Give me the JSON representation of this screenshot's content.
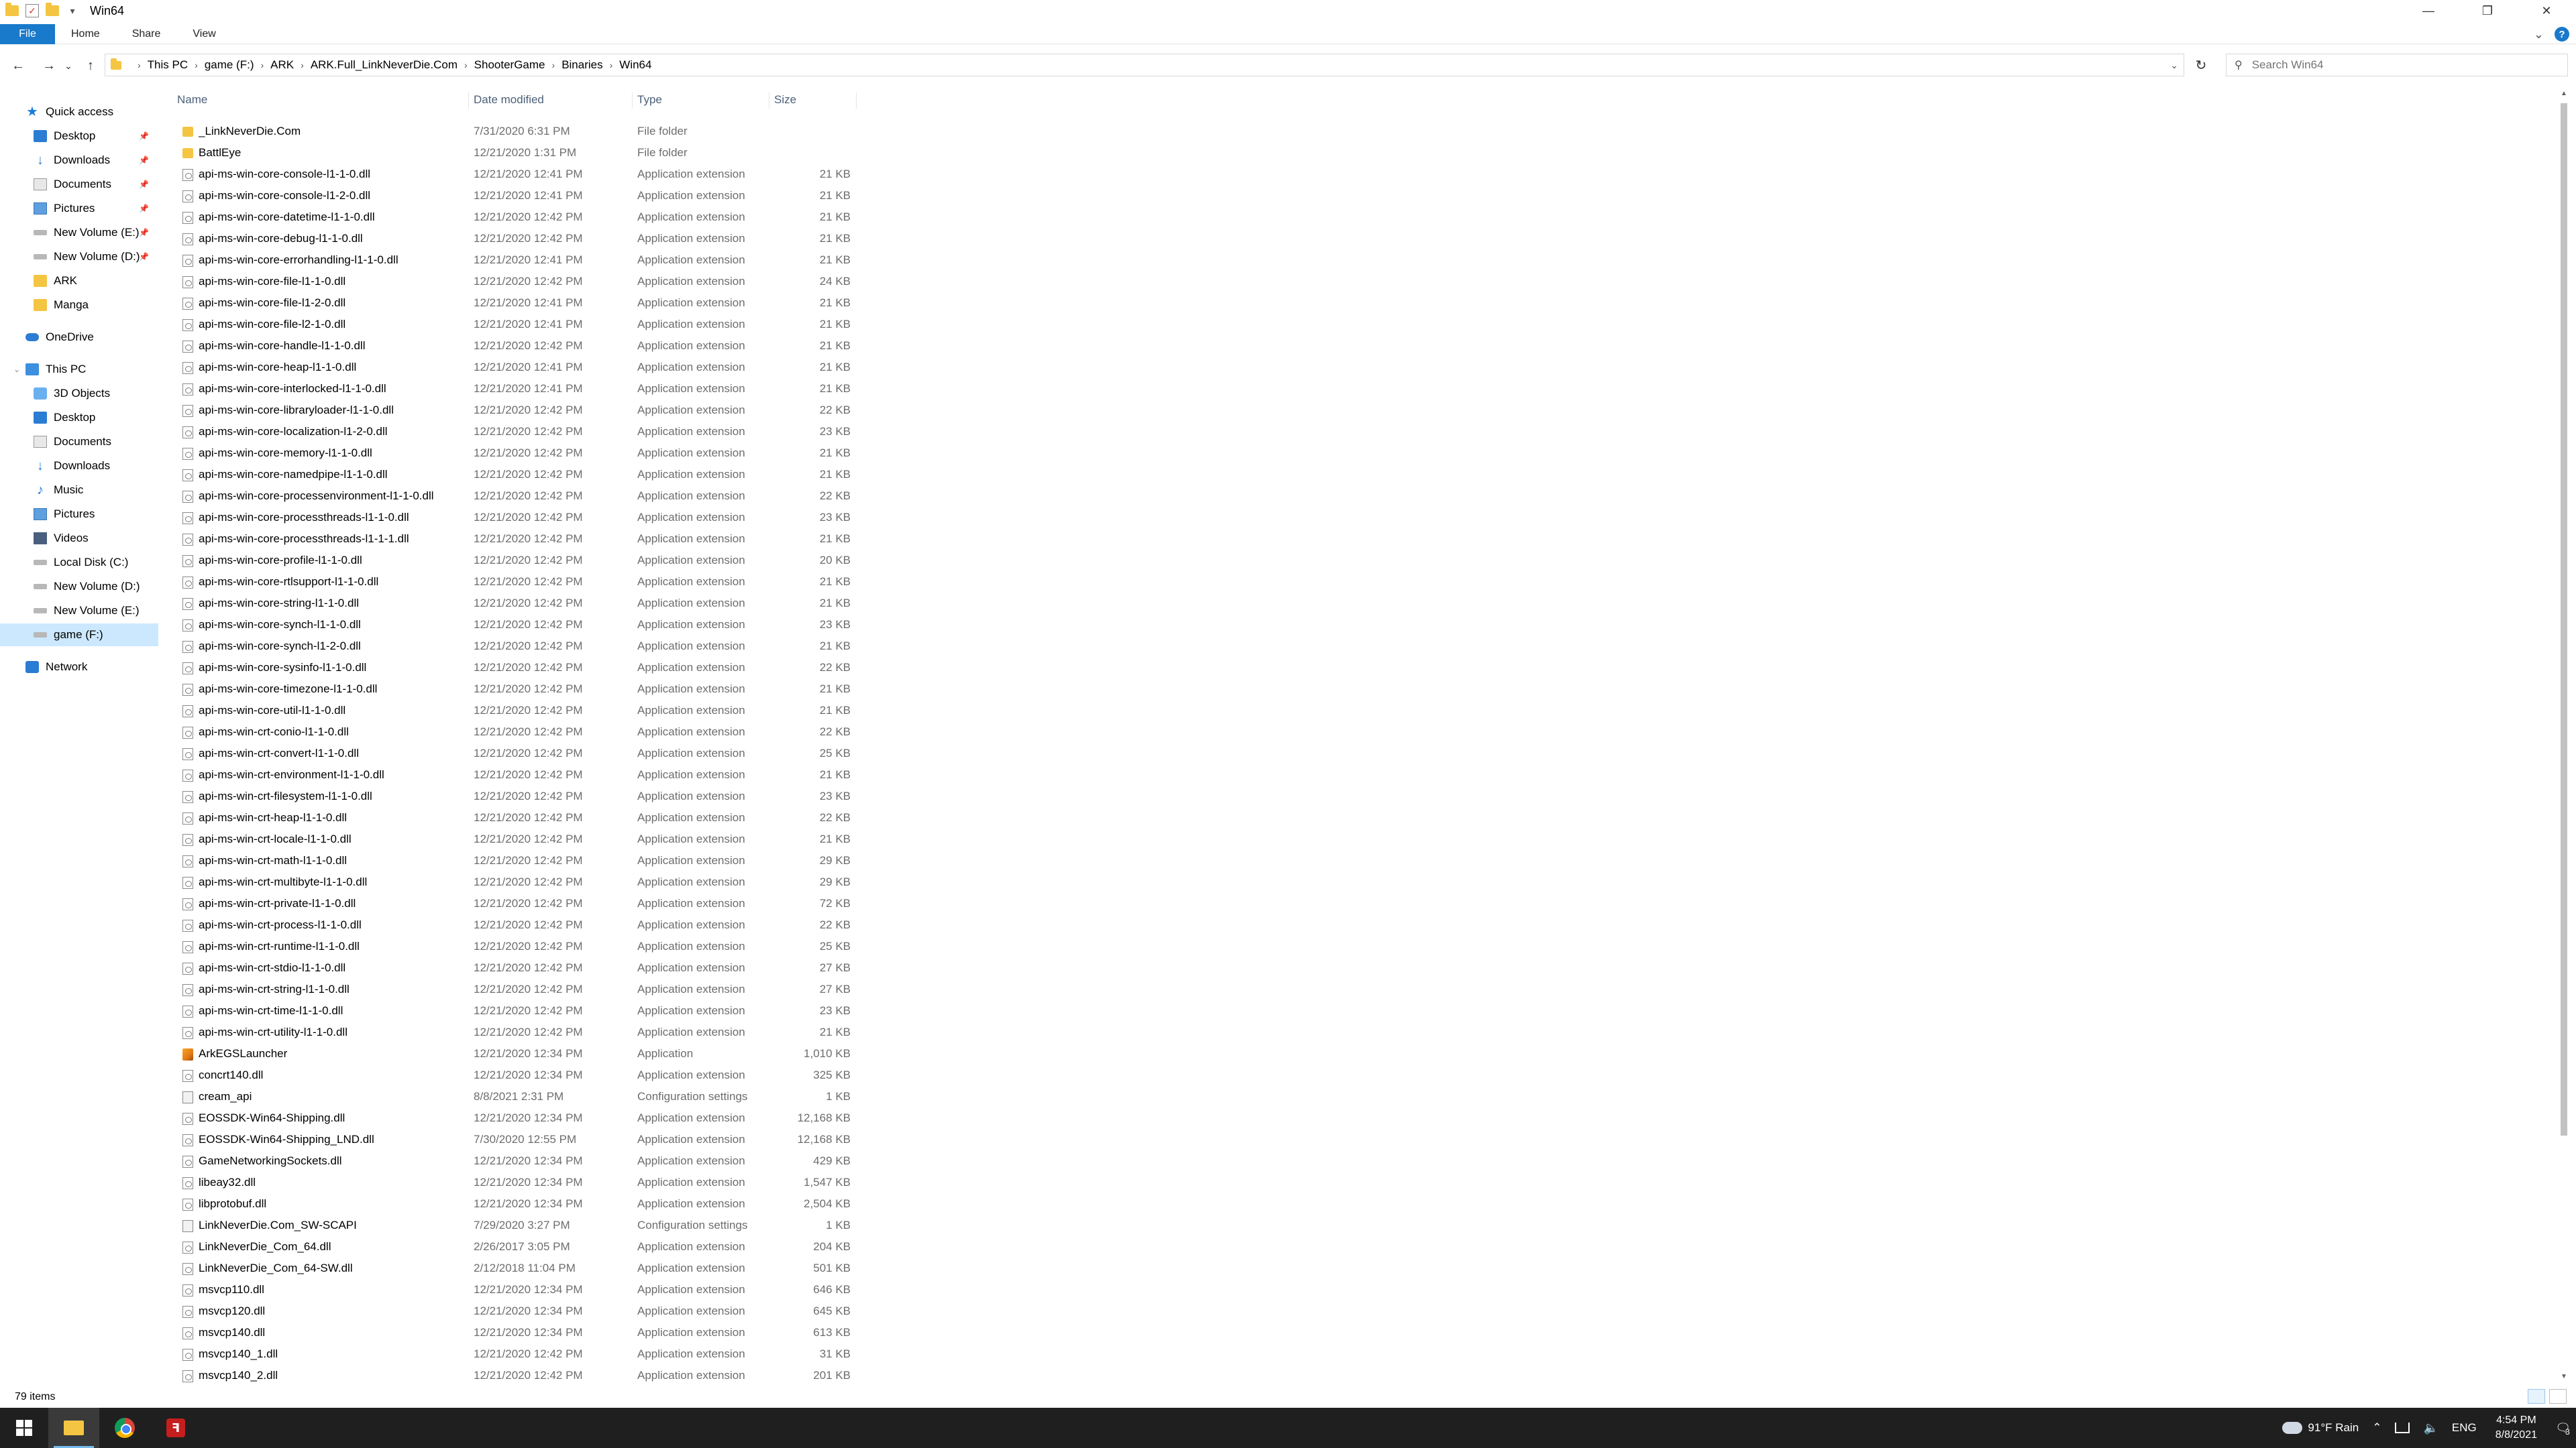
{
  "window": {
    "title": "Win64",
    "minimize": "—",
    "maximize": "❐",
    "close": "✕"
  },
  "ribbon": {
    "tabs": [
      "File",
      "Home",
      "Share",
      "View"
    ],
    "collapse_glyph": "⌄",
    "help_glyph": "?"
  },
  "nav": {
    "back": "←",
    "forward": "→",
    "recent": "⌄",
    "up": "↑",
    "refresh": "↻"
  },
  "address": {
    "crumbs": [
      "This PC",
      "game (F:)",
      "ARK",
      "ARK.Full_LinkNeverDie.Com",
      "ShooterGame",
      "Binaries",
      "Win64"
    ],
    "dropdown": "⌄"
  },
  "search": {
    "placeholder": "Search Win64"
  },
  "sidebar": {
    "quick_access": {
      "label": "Quick access",
      "items": [
        "Desktop",
        "Downloads",
        "Documents",
        "Pictures",
        "New Volume (E:)",
        "New Volume (D:)",
        "ARK",
        "Manga"
      ]
    },
    "onedrive": "OneDrive",
    "this_pc": {
      "label": "This PC",
      "items": [
        "3D Objects",
        "Desktop",
        "Documents",
        "Downloads",
        "Music",
        "Pictures",
        "Videos",
        "Local Disk (C:)",
        "New Volume (D:)",
        "New Volume (E:)",
        "game (F:)"
      ]
    },
    "network": "Network"
  },
  "columns": {
    "name": "Name",
    "date": "Date modified",
    "type": "Type",
    "size": "Size"
  },
  "files": [
    {
      "name": "_LinkNeverDie.Com",
      "date": "7/31/2020 6:31 PM",
      "type": "File folder",
      "size": ""
    },
    {
      "name": "BattlEye",
      "date": "12/21/2020 1:31 PM",
      "type": "File folder",
      "size": ""
    },
    {
      "name": "api-ms-win-core-console-l1-1-0.dll",
      "date": "12/21/2020 12:41 PM",
      "type": "Application extension",
      "size": "21 KB"
    },
    {
      "name": "api-ms-win-core-console-l1-2-0.dll",
      "date": "12/21/2020 12:41 PM",
      "type": "Application extension",
      "size": "21 KB"
    },
    {
      "name": "api-ms-win-core-datetime-l1-1-0.dll",
      "date": "12/21/2020 12:42 PM",
      "type": "Application extension",
      "size": "21 KB"
    },
    {
      "name": "api-ms-win-core-debug-l1-1-0.dll",
      "date": "12/21/2020 12:42 PM",
      "type": "Application extension",
      "size": "21 KB"
    },
    {
      "name": "api-ms-win-core-errorhandling-l1-1-0.dll",
      "date": "12/21/2020 12:41 PM",
      "type": "Application extension",
      "size": "21 KB"
    },
    {
      "name": "api-ms-win-core-file-l1-1-0.dll",
      "date": "12/21/2020 12:42 PM",
      "type": "Application extension",
      "size": "24 KB"
    },
    {
      "name": "api-ms-win-core-file-l1-2-0.dll",
      "date": "12/21/2020 12:41 PM",
      "type": "Application extension",
      "size": "21 KB"
    },
    {
      "name": "api-ms-win-core-file-l2-1-0.dll",
      "date": "12/21/2020 12:41 PM",
      "type": "Application extension",
      "size": "21 KB"
    },
    {
      "name": "api-ms-win-core-handle-l1-1-0.dll",
      "date": "12/21/2020 12:42 PM",
      "type": "Application extension",
      "size": "21 KB"
    },
    {
      "name": "api-ms-win-core-heap-l1-1-0.dll",
      "date": "12/21/2020 12:41 PM",
      "type": "Application extension",
      "size": "21 KB"
    },
    {
      "name": "api-ms-win-core-interlocked-l1-1-0.dll",
      "date": "12/21/2020 12:41 PM",
      "type": "Application extension",
      "size": "21 KB"
    },
    {
      "name": "api-ms-win-core-libraryloader-l1-1-0.dll",
      "date": "12/21/2020 12:42 PM",
      "type": "Application extension",
      "size": "22 KB"
    },
    {
      "name": "api-ms-win-core-localization-l1-2-0.dll",
      "date": "12/21/2020 12:42 PM",
      "type": "Application extension",
      "size": "23 KB"
    },
    {
      "name": "api-ms-win-core-memory-l1-1-0.dll",
      "date": "12/21/2020 12:42 PM",
      "type": "Application extension",
      "size": "21 KB"
    },
    {
      "name": "api-ms-win-core-namedpipe-l1-1-0.dll",
      "date": "12/21/2020 12:42 PM",
      "type": "Application extension",
      "size": "21 KB"
    },
    {
      "name": "api-ms-win-core-processenvironment-l1-1-0.dll",
      "date": "12/21/2020 12:42 PM",
      "type": "Application extension",
      "size": "22 KB"
    },
    {
      "name": "api-ms-win-core-processthreads-l1-1-0.dll",
      "date": "12/21/2020 12:42 PM",
      "type": "Application extension",
      "size": "23 KB"
    },
    {
      "name": "api-ms-win-core-processthreads-l1-1-1.dll",
      "date": "12/21/2020 12:42 PM",
      "type": "Application extension",
      "size": "21 KB"
    },
    {
      "name": "api-ms-win-core-profile-l1-1-0.dll",
      "date": "12/21/2020 12:42 PM",
      "type": "Application extension",
      "size": "20 KB"
    },
    {
      "name": "api-ms-win-core-rtlsupport-l1-1-0.dll",
      "date": "12/21/2020 12:42 PM",
      "type": "Application extension",
      "size": "21 KB"
    },
    {
      "name": "api-ms-win-core-string-l1-1-0.dll",
      "date": "12/21/2020 12:42 PM",
      "type": "Application extension",
      "size": "21 KB"
    },
    {
      "name": "api-ms-win-core-synch-l1-1-0.dll",
      "date": "12/21/2020 12:42 PM",
      "type": "Application extension",
      "size": "23 KB"
    },
    {
      "name": "api-ms-win-core-synch-l1-2-0.dll",
      "date": "12/21/2020 12:42 PM",
      "type": "Application extension",
      "size": "21 KB"
    },
    {
      "name": "api-ms-win-core-sysinfo-l1-1-0.dll",
      "date": "12/21/2020 12:42 PM",
      "type": "Application extension",
      "size": "22 KB"
    },
    {
      "name": "api-ms-win-core-timezone-l1-1-0.dll",
      "date": "12/21/2020 12:42 PM",
      "type": "Application extension",
      "size": "21 KB"
    },
    {
      "name": "api-ms-win-core-util-l1-1-0.dll",
      "date": "12/21/2020 12:42 PM",
      "type": "Application extension",
      "size": "21 KB"
    },
    {
      "name": "api-ms-win-crt-conio-l1-1-0.dll",
      "date": "12/21/2020 12:42 PM",
      "type": "Application extension",
      "size": "22 KB"
    },
    {
      "name": "api-ms-win-crt-convert-l1-1-0.dll",
      "date": "12/21/2020 12:42 PM",
      "type": "Application extension",
      "size": "25 KB"
    },
    {
      "name": "api-ms-win-crt-environment-l1-1-0.dll",
      "date": "12/21/2020 12:42 PM",
      "type": "Application extension",
      "size": "21 KB"
    },
    {
      "name": "api-ms-win-crt-filesystem-l1-1-0.dll",
      "date": "12/21/2020 12:42 PM",
      "type": "Application extension",
      "size": "23 KB"
    },
    {
      "name": "api-ms-win-crt-heap-l1-1-0.dll",
      "date": "12/21/2020 12:42 PM",
      "type": "Application extension",
      "size": "22 KB"
    },
    {
      "name": "api-ms-win-crt-locale-l1-1-0.dll",
      "date": "12/21/2020 12:42 PM",
      "type": "Application extension",
      "size": "21 KB"
    },
    {
      "name": "api-ms-win-crt-math-l1-1-0.dll",
      "date": "12/21/2020 12:42 PM",
      "type": "Application extension",
      "size": "29 KB"
    },
    {
      "name": "api-ms-win-crt-multibyte-l1-1-0.dll",
      "date": "12/21/2020 12:42 PM",
      "type": "Application extension",
      "size": "29 KB"
    },
    {
      "name": "api-ms-win-crt-private-l1-1-0.dll",
      "date": "12/21/2020 12:42 PM",
      "type": "Application extension",
      "size": "72 KB"
    },
    {
      "name": "api-ms-win-crt-process-l1-1-0.dll",
      "date": "12/21/2020 12:42 PM",
      "type": "Application extension",
      "size": "22 KB"
    },
    {
      "name": "api-ms-win-crt-runtime-l1-1-0.dll",
      "date": "12/21/2020 12:42 PM",
      "type": "Application extension",
      "size": "25 KB"
    },
    {
      "name": "api-ms-win-crt-stdio-l1-1-0.dll",
      "date": "12/21/2020 12:42 PM",
      "type": "Application extension",
      "size": "27 KB"
    },
    {
      "name": "api-ms-win-crt-string-l1-1-0.dll",
      "date": "12/21/2020 12:42 PM",
      "type": "Application extension",
      "size": "27 KB"
    },
    {
      "name": "api-ms-win-crt-time-l1-1-0.dll",
      "date": "12/21/2020 12:42 PM",
      "type": "Application extension",
      "size": "23 KB"
    },
    {
      "name": "api-ms-win-crt-utility-l1-1-0.dll",
      "date": "12/21/2020 12:42 PM",
      "type": "Application extension",
      "size": "21 KB"
    },
    {
      "name": "ArkEGSLauncher",
      "date": "12/21/2020 12:34 PM",
      "type": "Application",
      "size": "1,010 KB"
    },
    {
      "name": "concrt140.dll",
      "date": "12/21/2020 12:34 PM",
      "type": "Application extension",
      "size": "325 KB"
    },
    {
      "name": "cream_api",
      "date": "8/8/2021 2:31 PM",
      "type": "Configuration settings",
      "size": "1 KB"
    },
    {
      "name": "EOSSDK-Win64-Shipping.dll",
      "date": "12/21/2020 12:34 PM",
      "type": "Application extension",
      "size": "12,168 KB"
    },
    {
      "name": "EOSSDK-Win64-Shipping_LND.dll",
      "date": "7/30/2020 12:55 PM",
      "type": "Application extension",
      "size": "12,168 KB"
    },
    {
      "name": "GameNetworkingSockets.dll",
      "date": "12/21/2020 12:34 PM",
      "type": "Application extension",
      "size": "429 KB"
    },
    {
      "name": "libeay32.dll",
      "date": "12/21/2020 12:34 PM",
      "type": "Application extension",
      "size": "1,547 KB"
    },
    {
      "name": "libprotobuf.dll",
      "date": "12/21/2020 12:34 PM",
      "type": "Application extension",
      "size": "2,504 KB"
    },
    {
      "name": "LinkNeverDie.Com_SW-SCAPI",
      "date": "7/29/2020 3:27 PM",
      "type": "Configuration settings",
      "size": "1 KB"
    },
    {
      "name": "LinkNeverDie_Com_64.dll",
      "date": "2/26/2017 3:05 PM",
      "type": "Application extension",
      "size": "204 KB"
    },
    {
      "name": "LinkNeverDie_Com_64-SW.dll",
      "date": "2/12/2018 11:04 PM",
      "type": "Application extension",
      "size": "501 KB"
    },
    {
      "name": "msvcp110.dll",
      "date": "12/21/2020 12:34 PM",
      "type": "Application extension",
      "size": "646 KB"
    },
    {
      "name": "msvcp120.dll",
      "date": "12/21/2020 12:34 PM",
      "type": "Application extension",
      "size": "645 KB"
    },
    {
      "name": "msvcp140.dll",
      "date": "12/21/2020 12:34 PM",
      "type": "Application extension",
      "size": "613 KB"
    },
    {
      "name": "msvcp140_1.dll",
      "date": "12/21/2020 12:42 PM",
      "type": "Application extension",
      "size": "31 KB"
    },
    {
      "name": "msvcp140_2.dll",
      "date": "12/21/2020 12:42 PM",
      "type": "Application extension",
      "size": "201 KB"
    }
  ],
  "status": {
    "item_count": "79 items"
  },
  "taskbar": {
    "weather": "91°F  Rain",
    "tray_up": "⌃",
    "language": "ENG",
    "time": "4:54 PM",
    "date": "8/8/2021",
    "notifications": "3"
  },
  "colors": {
    "accent": "#1979ca",
    "selected": "#cce8ff",
    "taskbar": "#1f1f1f"
  }
}
